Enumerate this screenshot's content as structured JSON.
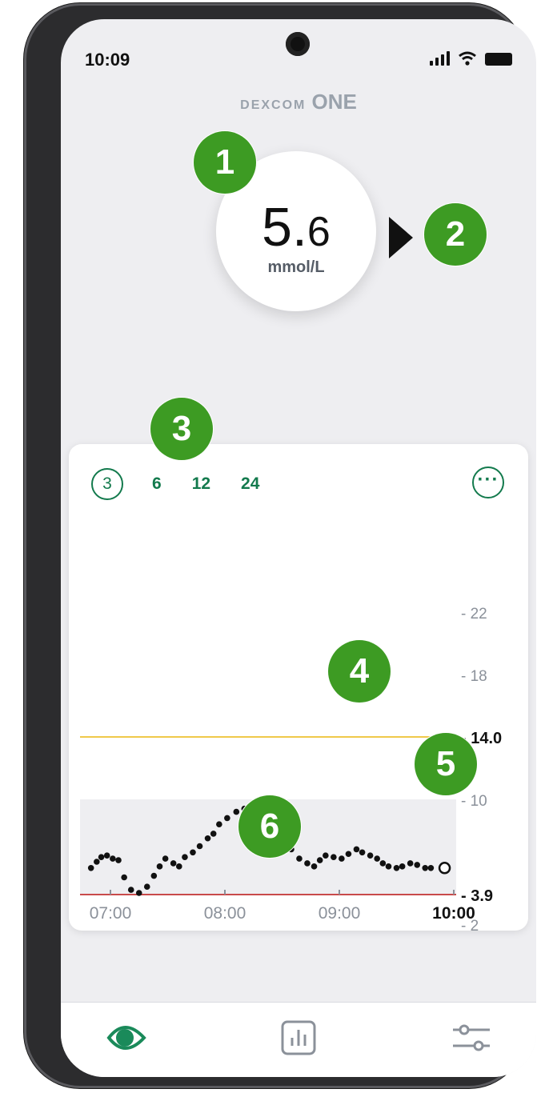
{
  "status_bar": {
    "time": "10:09"
  },
  "brand": {
    "small": "DEXCOM",
    "big": "ONE"
  },
  "glucose": {
    "integer": "5.",
    "decimal": "6",
    "unit": "mmol/L"
  },
  "callouts": [
    "1",
    "2",
    "3",
    "4",
    "5",
    "6"
  ],
  "time_range": {
    "options": [
      "3",
      "6",
      "12",
      "24"
    ],
    "selected": "3",
    "more_label": "···"
  },
  "chart_data": {
    "type": "scatter",
    "y_ticks": [
      {
        "label": "- 22",
        "value": 22
      },
      {
        "label": "- 18",
        "value": 18
      },
      {
        "label": "- 14.0",
        "value": 14.0
      },
      {
        "label": "- 10",
        "value": 10
      },
      {
        "label": "- 3.9",
        "value": 3.9
      },
      {
        "label": "- 2",
        "value": 2
      }
    ],
    "x_ticks": [
      {
        "label": "07:00",
        "value": 7.0
      },
      {
        "label": "08:00",
        "value": 8.0
      },
      {
        "label": "09:00",
        "value": 9.0
      },
      {
        "label": "10:00",
        "value": 10.0
      }
    ],
    "high_threshold": 14.0,
    "low_threshold": 3.9,
    "target_range": [
      3.9,
      10
    ],
    "high_color": "#f0c94a",
    "low_color": "#c94a4a",
    "points_x": [
      6.83,
      6.88,
      6.92,
      6.97,
      7.02,
      7.07,
      7.12,
      7.18,
      7.25,
      7.32,
      7.38,
      7.43,
      7.48,
      7.55,
      7.6,
      7.65,
      7.72,
      7.78,
      7.85,
      7.9,
      7.95,
      8.02,
      8.1,
      8.17,
      8.25,
      8.32,
      8.38,
      8.45,
      8.52,
      8.58,
      8.65,
      8.72,
      8.78,
      8.83,
      8.88,
      8.95,
      9.02,
      9.08,
      9.15,
      9.2,
      9.27,
      9.33,
      9.38,
      9.43,
      9.5,
      9.55,
      9.62,
      9.68,
      9.75,
      9.8
    ],
    "points_y": [
      5.6,
      6.0,
      6.3,
      6.4,
      6.2,
      6.1,
      5.0,
      4.2,
      4.0,
      4.4,
      5.1,
      5.7,
      6.2,
      5.9,
      5.7,
      6.3,
      6.6,
      7.0,
      7.5,
      7.8,
      8.4,
      8.8,
      9.2,
      9.4,
      9.6,
      9.2,
      8.6,
      8.2,
      7.4,
      6.8,
      6.2,
      5.9,
      5.7,
      6.1,
      6.4,
      6.3,
      6.2,
      6.5,
      6.8,
      6.6,
      6.4,
      6.2,
      5.9,
      5.7,
      5.6,
      5.7,
      5.9,
      5.8,
      5.6,
      5.6
    ],
    "current_point": {
      "x": 9.92,
      "y": 5.6
    }
  },
  "nav": {
    "home": "eye-icon",
    "history": "bar-chart-icon",
    "settings": "sliders-icon"
  }
}
